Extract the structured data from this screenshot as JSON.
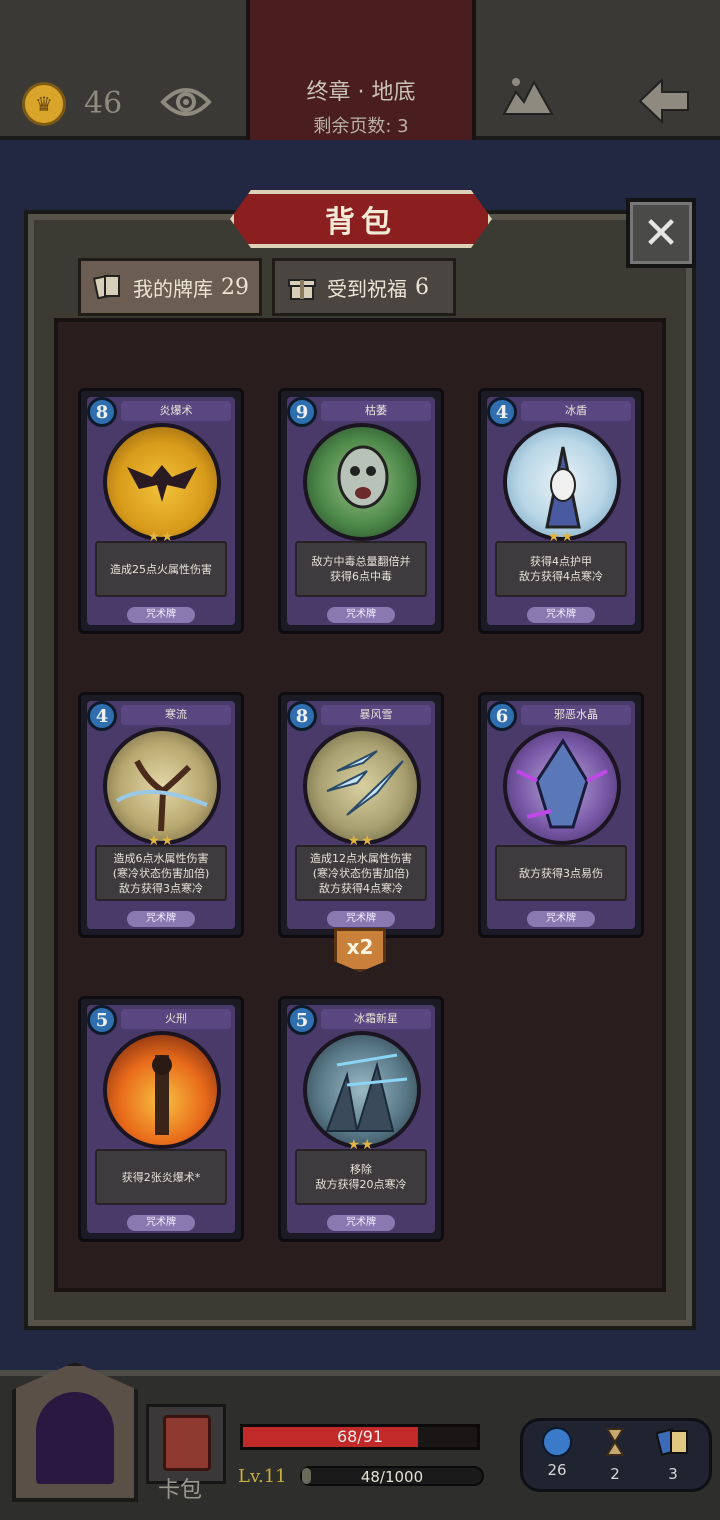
{
  "header": {
    "coins": "46",
    "chapter_title": "终章 · 地底",
    "pages_left": "剩余页数: 3"
  },
  "panel": {
    "title": "背包",
    "close_label": "✕",
    "tabs": [
      {
        "label": "我的牌库",
        "count": "29"
      },
      {
        "label": "受到祝福",
        "count": "6"
      }
    ]
  },
  "cards": [
    {
      "cost": "8",
      "name": "炎爆术",
      "desc_line1": "造成25点火属性伤害",
      "desc_line2": "",
      "desc_line3": "",
      "type": "咒术牌",
      "stars": "★★"
    },
    {
      "cost": "9",
      "name": "枯萎",
      "desc_line1": "敌方中毒总量翻倍并",
      "desc_line2": "获得6点中毒",
      "desc_line3": "",
      "type": "咒术牌",
      "stars": ""
    },
    {
      "cost": "4",
      "name": "冰盾",
      "desc_line1": "获得4点护甲",
      "desc_line2": "敌方获得4点寒冷",
      "desc_line3": "",
      "type": "咒术牌",
      "stars": "★★"
    },
    {
      "cost": "4",
      "name": "寒流",
      "desc_line1": "造成6点水属性伤害",
      "desc_line2": "(寒冷状态伤害加倍)",
      "desc_line3": "敌方获得3点寒冷",
      "type": "咒术牌",
      "stars": "★★"
    },
    {
      "cost": "8",
      "name": "暴风雪",
      "desc_line1": "造成12点水属性伤害",
      "desc_line2": "(寒冷状态伤害加倍)",
      "desc_line3": "敌方获得4点寒冷",
      "type": "咒术牌",
      "stars": "★★"
    },
    {
      "cost": "6",
      "name": "邪恶水晶",
      "desc_line1": "敌方获得3点易伤",
      "desc_line2": "",
      "desc_line3": "",
      "type": "咒术牌",
      "stars": ""
    },
    {
      "cost": "5",
      "name": "火刑",
      "desc_line1": "获得2张炎爆术*",
      "desc_line2": "",
      "desc_line3": "",
      "type": "咒术牌",
      "stars": ""
    },
    {
      "cost": "5",
      "name": "冰霜新星",
      "desc_line1": "移除",
      "desc_line2": "敌方获得20点寒冷",
      "desc_line3": "",
      "type": "咒术牌",
      "stars": "★★"
    }
  ],
  "duplicate_badge": "x2",
  "footer": {
    "bag_label": "卡包",
    "hp": "68/91",
    "hp_fraction": 0.747,
    "level": "Lv.11",
    "xp": "48/1000",
    "xp_fraction": 0.048,
    "resources": {
      "orbs": "26",
      "hourglass": "2",
      "cards": "3"
    }
  }
}
